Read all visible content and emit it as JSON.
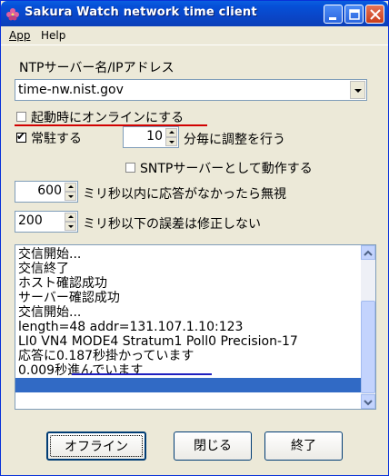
{
  "window": {
    "title": "Sakura Watch network time client"
  },
  "menu": {
    "app": "App",
    "help": "Help"
  },
  "ntp": {
    "label": "NTPサーバー名/IPアドレス",
    "server": "time-nw.nist.gov"
  },
  "options": {
    "online_at_startup": {
      "label": "起動時にオンラインにする",
      "checked": false
    },
    "resident": {
      "label": "常駐する",
      "checked": true
    },
    "adjust_interval": {
      "value": "10",
      "suffix": "分毎に調整を行う"
    },
    "sntp_server": {
      "label": "SNTPサーバーとして動作する",
      "checked": false
    },
    "timeout": {
      "value": "600",
      "suffix": "ミリ秒以内に応答がなかったら無視"
    },
    "ignore_error": {
      "value": "200",
      "suffix": "ミリ秒以下の誤差は修正しない"
    }
  },
  "log": {
    "lines": [
      "交信開始...",
      "交信終了",
      "ホスト確認成功",
      "サーバー確認成功",
      "交信開始...",
      "length=48 addr=131.107.1.10:123",
      "LI0 VN4 MODE4 Stratum1 Poll0 Precision-17",
      "応答に0.187秒掛かっています",
      "0.009秒進んでいます",
      ""
    ]
  },
  "buttons": {
    "offline": "オフライン",
    "close": "閉じる",
    "exit": "終了"
  },
  "colors": {
    "titlebar": "#0a46c8",
    "selection": "#316ac5",
    "red_underline": "#d10000",
    "blue_underline": "#2020c0"
  }
}
